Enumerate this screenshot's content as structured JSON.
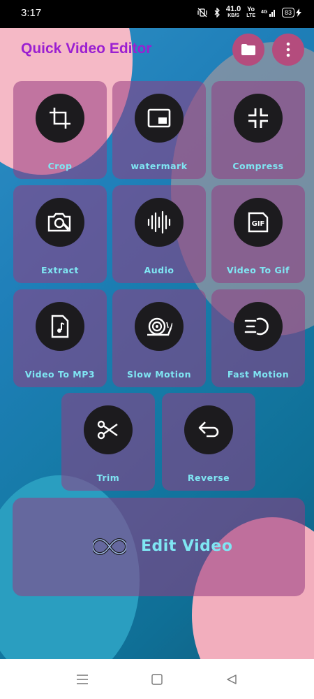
{
  "status": {
    "time": "3:17",
    "speed_value": "41.0",
    "speed_unit": "KB/S",
    "network": "4G",
    "network_type": "LTE",
    "battery": "83"
  },
  "header": {
    "title": "Quick Video Editor",
    "title_color": "#9b1fd1",
    "folder_icon": "folder-icon",
    "menu_icon": "more-vert-icon"
  },
  "tools": [
    {
      "label": "Crop",
      "icon": "crop-icon"
    },
    {
      "label": "watermark",
      "icon": "picture-in-picture-icon"
    },
    {
      "label": "Compress",
      "icon": "compress-icon"
    },
    {
      "label": "Extract",
      "icon": "camera-extract-icon"
    },
    {
      "label": "Audio",
      "icon": "audio-waveform-icon"
    },
    {
      "label": "Video To Gif",
      "icon": "gif-icon"
    },
    {
      "label": "Video To MP3",
      "icon": "audio-file-icon"
    },
    {
      "label": "Slow Motion",
      "icon": "snail-icon"
    },
    {
      "label": "Fast Motion",
      "icon": "fast-forward-icon"
    },
    {
      "label": "Trim",
      "icon": "scissors-icon"
    },
    {
      "label": "Reverse",
      "icon": "reverse-arrow-icon"
    }
  ],
  "edit": {
    "label": "Edit Video",
    "icon": "infinity-logo-icon"
  },
  "colors": {
    "label_color": "#7fe6f3",
    "tile_color": "#963c82",
    "circle_color": "#1c1b1e"
  }
}
